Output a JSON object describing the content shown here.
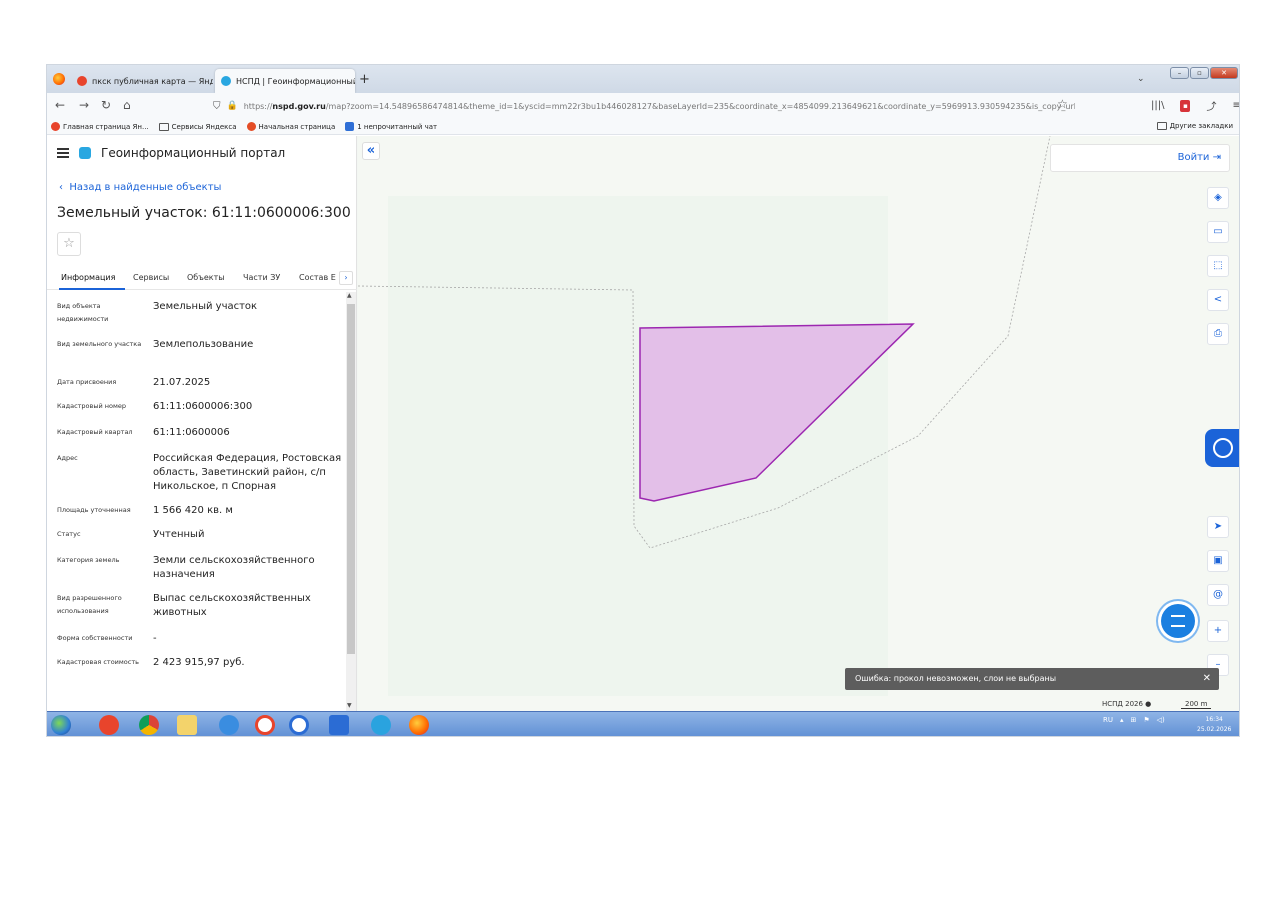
{
  "browser": {
    "tabs": [
      {
        "title": "пкск публичная карта — Янд",
        "favicon_color": "#e8442c"
      },
      {
        "title": "НСПД | Геоинформационный",
        "favicon_color": "#29a7e1"
      }
    ],
    "url_prefix": "https://",
    "url_domain": "nspd.gov.ru",
    "url_rest": "/map?zoom=14.54896586474814&theme_id=1&yscid=mm22r3bu1b446028127&baseLayerId=235&coordinate_x=4854099.213649621&coordinate_y=5969913.930594235&is_copy_url=t",
    "bookmarks": [
      "Главная страница Ян...",
      "Сервисы Яндекса",
      "Начальная страница",
      "1 непрочитанный чат"
    ],
    "other_bookmarks": "Другие закладки"
  },
  "portal": {
    "title": "Геоинформационный портал",
    "back_link": "Назад в найденные объекты",
    "object_title": "Земельный участок: 61:11:0600006:300",
    "tabs": [
      "Информация",
      "Сервисы",
      "Объекты",
      "Части ЗУ",
      "Состав Е"
    ],
    "properties": [
      {
        "label": "Вид объекта недвижимости",
        "value": "Земельный участок"
      },
      {
        "label": "Вид земельного участка",
        "value": "Землепользование"
      },
      {
        "label": "Дата присвоения",
        "value": "21.07.2025"
      },
      {
        "label": "Кадастровый номер",
        "value": "61:11:0600006:300"
      },
      {
        "label": "Кадастровый квартал",
        "value": "61:11:0600006"
      },
      {
        "label": "Адрес",
        "value": "Российская Федерация, Ростовская область, Заветинский район, с/п Никольское, п Спорная"
      },
      {
        "label": "Площадь уточненная",
        "value": "1 566 420 кв. м"
      },
      {
        "label": "Статус",
        "value": "Учтенный"
      },
      {
        "label": "Категория земель",
        "value": "Земли сельскохозяйственного назначения"
      },
      {
        "label": "Вид разрешенного использования",
        "value": "Выпас сельскохозяйственных животных"
      },
      {
        "label": "Форма собственности",
        "value": "-"
      },
      {
        "label": "Кадастровая стоимость",
        "value": "2 423 915,97 руб."
      }
    ]
  },
  "map": {
    "login": "Войти",
    "toast": "Ошибка: прокол невозможен, слои не выбраны",
    "attribution": "НСПД 2026",
    "scale": "200 m",
    "parcel_fill": "#e3bfe8",
    "parcel_stroke": "#9c27b0"
  },
  "taskbar": {
    "lang": "RU",
    "time": "16:34",
    "date": "25.02.2026"
  }
}
